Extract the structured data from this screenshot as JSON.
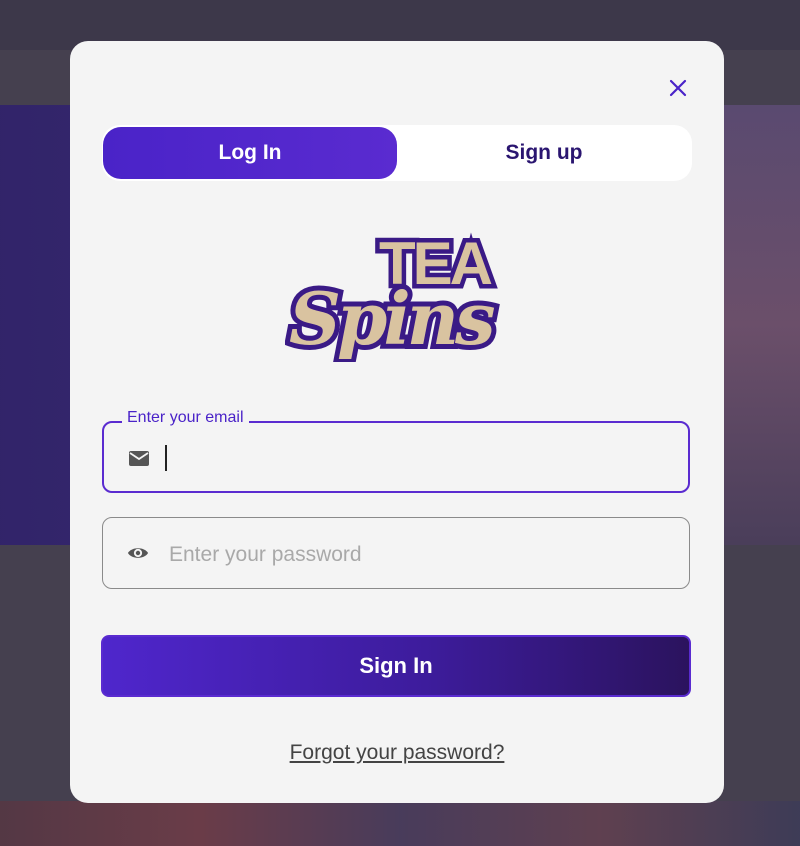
{
  "tabs": [
    {
      "label": "Log In",
      "active": true
    },
    {
      "label": "Sign up",
      "active": false
    }
  ],
  "logo": {
    "line1": "TEA",
    "line2": "Spins"
  },
  "email": {
    "legend": "Enter your email",
    "value": "",
    "icon": "envelope-icon"
  },
  "password": {
    "placeholder": "Enter your password",
    "icon": "eye-icon"
  },
  "signin_label": "Sign In",
  "forgot_label": "Forgot your password?",
  "colors": {
    "accent": "#5a2bd0",
    "accent_dark": "#2b135e",
    "logo_gold": "#d9c3a0"
  }
}
